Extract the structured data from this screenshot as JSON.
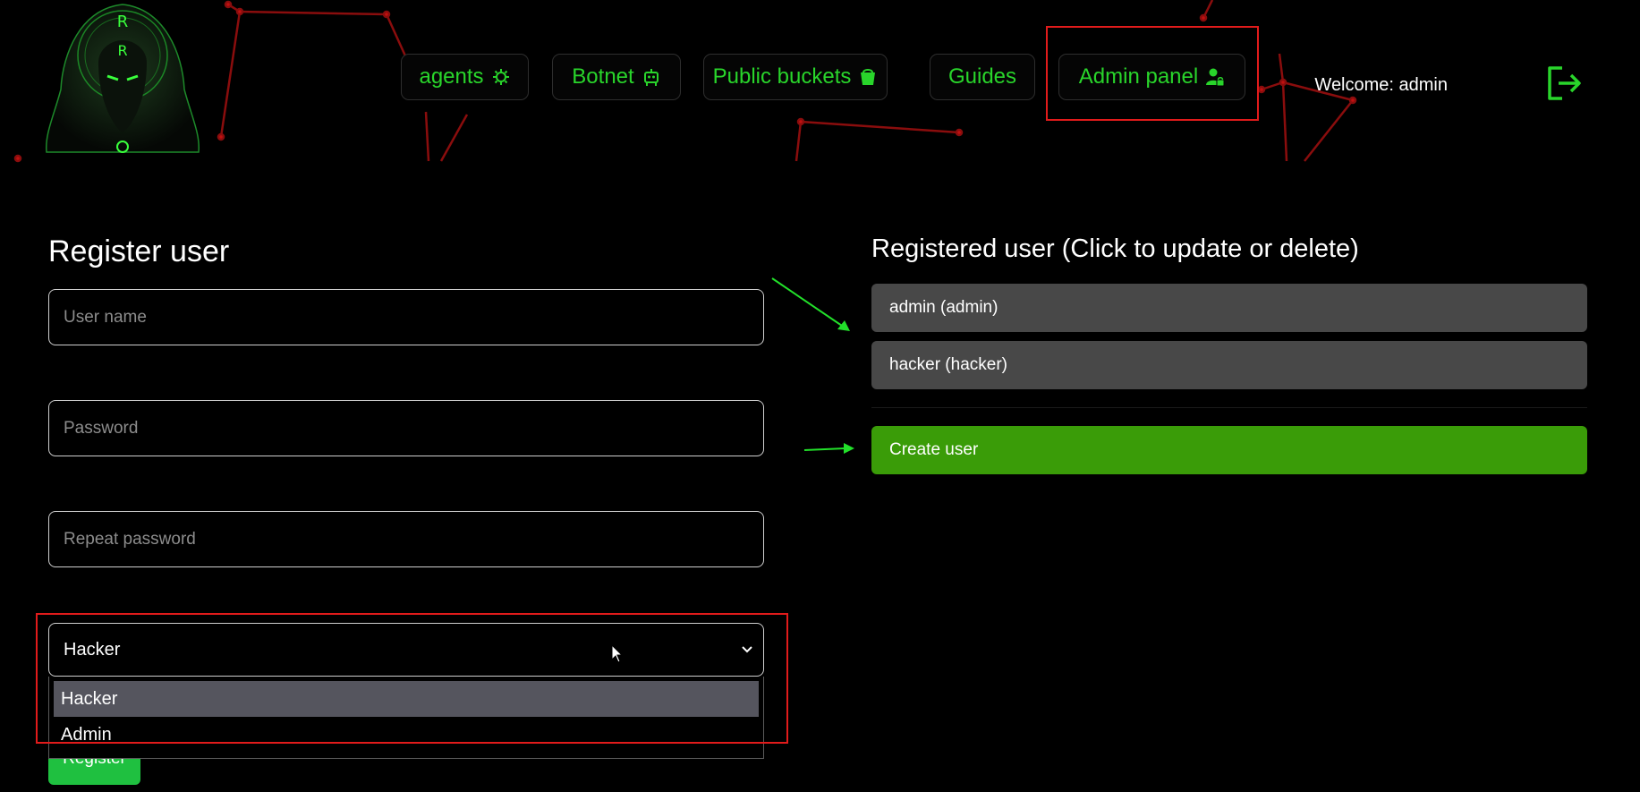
{
  "header": {
    "nav": [
      {
        "label": "agents",
        "icon": "gear-icon"
      },
      {
        "label": "Botnet",
        "icon": "robot-icon"
      },
      {
        "label": "Public buckets",
        "icon": "bucket-icon"
      },
      {
        "label": "Guides",
        "icon": ""
      },
      {
        "label": "Admin panel",
        "icon": "user-lock-icon"
      }
    ],
    "welcome": "Welcome: admin"
  },
  "register_form": {
    "title": "Register user",
    "username_placeholder": "User name",
    "password_placeholder": "Password",
    "repeat_password_placeholder": "Repeat password",
    "role_selected": "Hacker",
    "role_options": [
      "Hacker",
      "Admin"
    ],
    "register_label": "Register"
  },
  "users_panel": {
    "title": "Registered user (Click to update or delete)",
    "users": [
      "admin (admin)",
      "hacker (hacker)"
    ],
    "create_label": "Create user"
  },
  "colors": {
    "accent_green": "#29d52b",
    "create_green": "#3a9c08",
    "register_green": "#1fc040",
    "highlight_red": "#e11b1b",
    "row_gray": "#484848"
  }
}
